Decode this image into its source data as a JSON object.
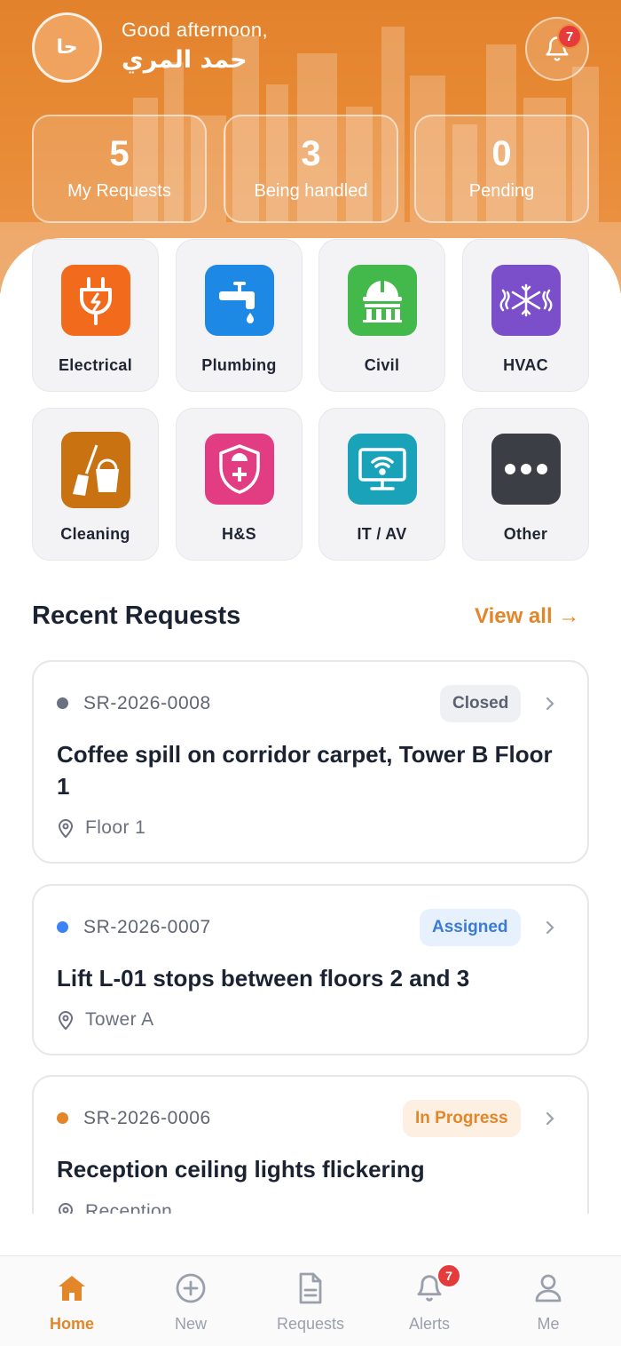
{
  "header": {
    "avatar_initials": "حا",
    "greeting": "Good afternoon,",
    "user_name": "حمد المري",
    "notification_count": "7"
  },
  "stats": [
    {
      "value": "5",
      "label": "My Requests"
    },
    {
      "value": "3",
      "label": "Being handled"
    },
    {
      "value": "0",
      "label": "Pending"
    }
  ],
  "categories": [
    {
      "label": "Electrical",
      "icon": "plug-icon",
      "color": "#f26b1d"
    },
    {
      "label": "Plumbing",
      "icon": "faucet-icon",
      "color": "#1e88e5"
    },
    {
      "label": "Civil",
      "icon": "hardhat-building-icon",
      "color": "#43b94b"
    },
    {
      "label": "HVAC",
      "icon": "snowflake-icon",
      "color": "#7a4fc9"
    },
    {
      "label": "Cleaning",
      "icon": "broom-bucket-icon",
      "color": "#c87212"
    },
    {
      "label": "H&S",
      "icon": "shield-cross-icon",
      "color": "#e23d83"
    },
    {
      "label": "IT / AV",
      "icon": "monitor-wifi-icon",
      "color": "#1aa3b8"
    },
    {
      "label": "Other",
      "icon": "more-dots-icon",
      "color": "#3b3e45"
    }
  ],
  "recent": {
    "title": "Recent Requests",
    "view_all": "View all →",
    "items": [
      {
        "code": "SR-2026-0008",
        "status": "Closed",
        "status_color": "#5b6170",
        "status_bg": "#eef0f3",
        "dot": "#6b7180",
        "title": "Coffee spill on corridor carpet, Tower B Floor 1",
        "location": "Floor 1"
      },
      {
        "code": "SR-2026-0007",
        "status": "Assigned",
        "status_color": "#3a7bd5",
        "status_bg": "#e7f1fd",
        "dot": "#3b82f6",
        "title": "Lift L-01 stops between floors 2 and 3",
        "location": "Tower A"
      },
      {
        "code": "SR-2026-0006",
        "status": "In Progress",
        "status_color": "#e38629",
        "status_bg": "#fdf0e2",
        "dot": "#e38629",
        "title": "Reception ceiling lights flickering",
        "location": "Reception"
      }
    ]
  },
  "nav": {
    "items": [
      {
        "label": "Home",
        "icon": "home-icon"
      },
      {
        "label": "New",
        "icon": "plus-circle-icon"
      },
      {
        "label": "Requests",
        "icon": "document-icon"
      },
      {
        "label": "Alerts",
        "icon": "bell-icon"
      },
      {
        "label": "Me",
        "icon": "user-icon"
      }
    ],
    "alerts_badge": "7",
    "accent": "#e38629"
  }
}
